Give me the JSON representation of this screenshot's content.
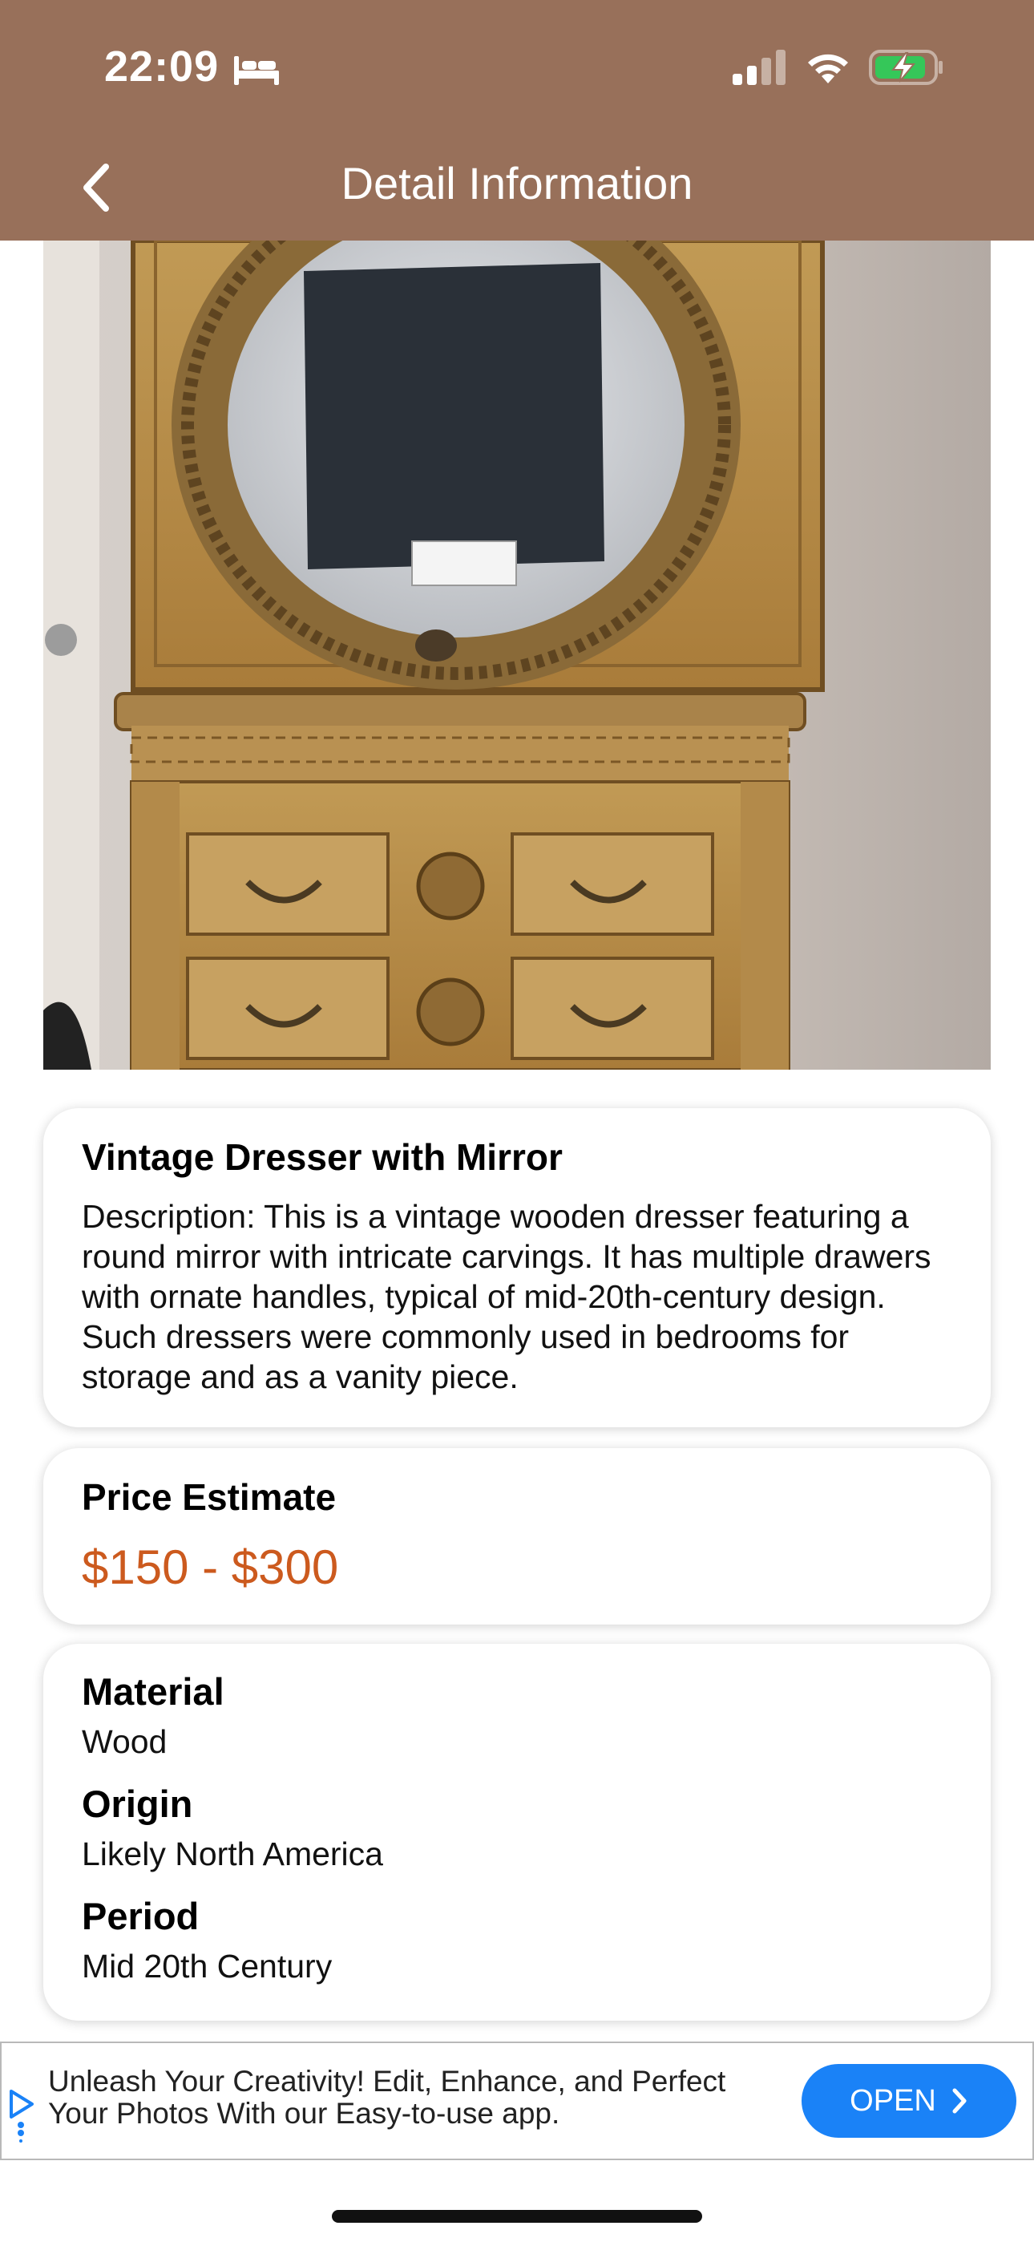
{
  "status_bar": {
    "time": "22:09"
  },
  "header": {
    "title": "Detail Information"
  },
  "item": {
    "name": "Vintage Dresser with Mirror",
    "description": "Description: This is a vintage wooden dresser featuring a round mirror with intricate carvings. It has multiple drawers with ornate handles, typical of mid-20th-century design. Such dressers were commonly used in bedrooms for storage and as a vanity piece."
  },
  "price": {
    "label": "Price Estimate",
    "value": "$150 - $300"
  },
  "details": {
    "material_label": "Material",
    "material": "Wood",
    "origin_label": "Origin",
    "origin": "Likely North America",
    "period_label": "Period",
    "period": "Mid 20th Century"
  },
  "ad": {
    "text": "Unleash Your Creativity! Edit, Enhance, and Perfect Your Photos With our Easy-to-use app.",
    "button": "OPEN"
  },
  "colors": {
    "header": "#98705a",
    "price": "#cc5a1e",
    "ad_button": "#1a82f7"
  },
  "icons": [
    "bed-icon",
    "signal-icon",
    "wifi-icon",
    "battery-charging-icon",
    "back-chevron-icon",
    "adchoices-icon",
    "chevron-right-icon"
  ]
}
